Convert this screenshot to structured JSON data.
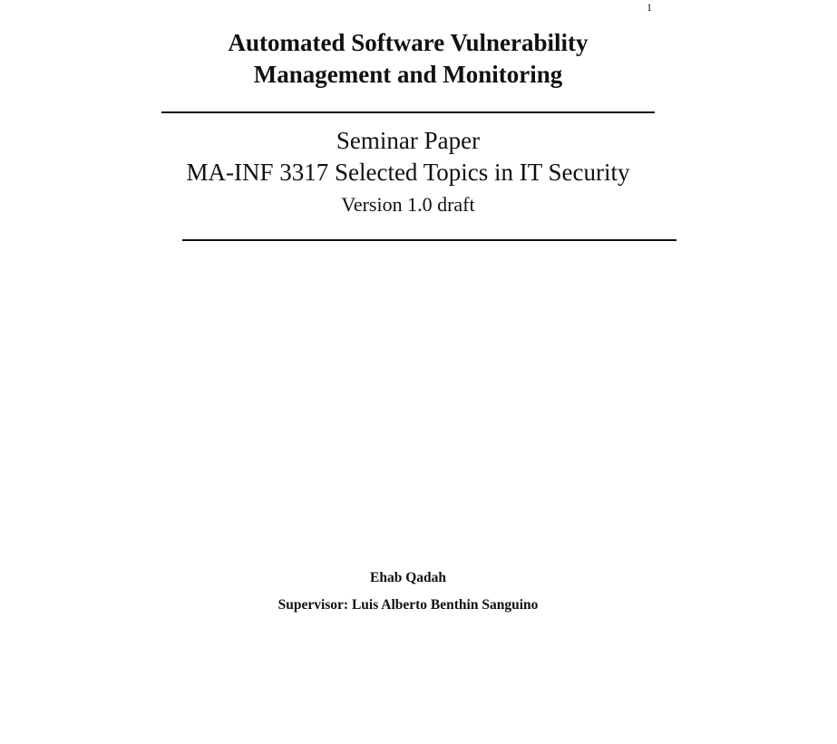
{
  "page_number": "1",
  "title": {
    "line1": "Automated Software Vulnerability",
    "line2": "Management and Monitoring"
  },
  "subtitle": {
    "type": "Seminar Paper",
    "course": "MA-INF 3317 Selected Topics in IT Security",
    "version": "Version 1.0 draft"
  },
  "author": "Ehab Qadah",
  "supervisor": "Supervisor: Luis Alberto Benthin Sanguino"
}
